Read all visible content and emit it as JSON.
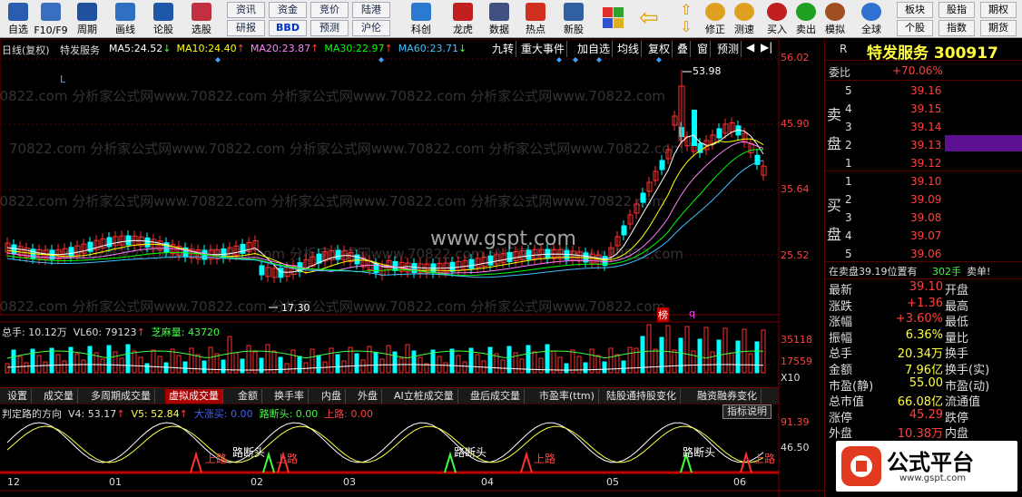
{
  "toolbar": {
    "buttons": [
      {
        "label": "自选",
        "icon": "self-select-icon",
        "color": "#2a5db0"
      },
      {
        "label": "F10/F9",
        "icon": "f10-icon",
        "color": "#3a6fc0"
      },
      {
        "label": "周期",
        "icon": "period-icon",
        "color": "#2050a0"
      },
      {
        "label": "画线",
        "icon": "draw-line-icon",
        "color": "#3070c0"
      },
      {
        "label": "论股",
        "icon": "discuss-icon",
        "color": "#1e56a8"
      },
      {
        "label": "选股",
        "icon": "stock-pick-icon",
        "color": "#c03040"
      }
    ],
    "grid_buttons": [
      {
        "label": "资讯"
      },
      {
        "label": "资金"
      },
      {
        "label": "竞价"
      },
      {
        "label": "陆港"
      },
      {
        "label": "研报"
      },
      {
        "label": "BBD"
      },
      {
        "label": "预测"
      },
      {
        "label": "沪伦"
      }
    ],
    "buttons2": [
      {
        "label": "科创",
        "icon": "kechuang-icon",
        "color": "#2a7ad0"
      },
      {
        "label": "龙虎",
        "icon": "longhu-icon",
        "color": "#c02020"
      },
      {
        "label": "数据",
        "icon": "data-icon",
        "color": "#405080"
      },
      {
        "label": "热点",
        "icon": "hot-icon",
        "color": "#d03020"
      },
      {
        "label": "新股",
        "icon": "newstock-icon",
        "color": "#3060a0"
      }
    ],
    "nav_buttons": [
      {
        "label": "修正",
        "icon": "fix-icon"
      },
      {
        "label": "测速",
        "icon": "speed-icon"
      },
      {
        "label": "买入",
        "icon": "buy-icon"
      },
      {
        "label": "卖出",
        "icon": "sell-icon"
      },
      {
        "label": "模拟",
        "icon": "simulate-icon"
      },
      {
        "label": "全球",
        "icon": "globe-icon"
      }
    ],
    "right_buttons": [
      "板块",
      "股指",
      "期权",
      "个股",
      "指数",
      "期货"
    ]
  },
  "chart": {
    "title": "日线(复权)",
    "stock_name": "特发服务",
    "ma": [
      {
        "label": "MA5:",
        "value": "24.52",
        "arrow": "↓",
        "color": "#ffffff"
      },
      {
        "label": "MA10:",
        "value": "24.40",
        "arrow": "↑",
        "color": "#ffff00"
      },
      {
        "label": "MA20:",
        "value": "23.87",
        "arrow": "↑",
        "color": "#ff80ff"
      },
      {
        "label": "MA30:",
        "value": "22.97",
        "arrow": "↑",
        "color": "#00ff00"
      },
      {
        "label": "MA60:",
        "value": "23.71",
        "arrow": "↓",
        "color": "#40c0ff"
      }
    ],
    "toolbar_right": [
      "九转",
      "重大事件",
      "加自选",
      "均线",
      "复权",
      "叠",
      "窗",
      "预测"
    ],
    "price_axis": [
      "56.02",
      "45.90",
      "35.64",
      "25.52"
    ],
    "high_label": "53.98",
    "low_label": "17.30",
    "watermark_text": "70822.com 分析家公式网www.70822.com 分析家公式网www.70822.com 分析家公式网www.70822.com",
    "watermark_site": "www.gspt.com",
    "marker_bang": "榜",
    "marker_q": "q",
    "marker_L": "L",
    "volume": {
      "label": "总手: 10.12万",
      "vl60": "VL60: 79123",
      "vl60_arrow": "↑",
      "zhima": "芝麻量: 43720",
      "axis_top": "35118",
      "axis_mid": "17559",
      "axis_unit": "X10"
    },
    "tabs": [
      "设置",
      "成交量",
      "多周期成交量",
      "虚拟成交量",
      "金额",
      "换手率",
      "内盘",
      "外盘",
      "AI立桩成交量",
      "盘后成交量",
      "市盈率(ttm)",
      "陆股通持股变化",
      "融资融券变化"
    ],
    "active_tab": "虚拟成交量",
    "indicator": {
      "title": "判定路的方向",
      "v4": "V4: 53.17",
      "v4_arrow": "↑",
      "v5": "V5: 52.84",
      "v5_arrow": "↑",
      "dazhang": "大涨买: 0.00",
      "luduan": "路断头: 0.00",
      "shanglu": "上路: 0.00",
      "help_button": "指标说明",
      "axis_top": "91.39",
      "axis_mid": "46.50",
      "labels": [
        "上路",
        "路断头",
        "上路",
        "路断头",
        "上路",
        "路断头",
        "上路"
      ]
    },
    "date_axis": [
      "12",
      "01",
      "02",
      "03",
      "04",
      "05",
      "06"
    ]
  },
  "quote": {
    "code_label": "R",
    "title": "特发服务 300917",
    "weibi_label": "委比",
    "weibi_value": "+70.06%",
    "sell_label": [
      "卖",
      "盘"
    ],
    "buy_label": [
      "买",
      "盘"
    ],
    "sells": [
      {
        "level": "5",
        "price": "39.16"
      },
      {
        "level": "4",
        "price": "39.15"
      },
      {
        "level": "3",
        "price": "39.14"
      },
      {
        "level": "2",
        "price": "39.13"
      },
      {
        "level": "1",
        "price": "39.12"
      }
    ],
    "buys": [
      {
        "level": "1",
        "price": "39.10"
      },
      {
        "level": "2",
        "price": "39.09"
      },
      {
        "level": "3",
        "price": "39.08"
      },
      {
        "level": "4",
        "price": "39.07"
      },
      {
        "level": "5",
        "price": "39.06"
      }
    ],
    "sell_info": "在卖盘39.19位置有",
    "sell_info_qty": "302手",
    "sell_info_tag": "卖单!",
    "stats": [
      {
        "k1": "最新",
        "v1": "39.10",
        "k2": "开盘",
        "c": "#ff4040"
      },
      {
        "k1": "涨跌",
        "v1": "+1.36",
        "k2": "最高",
        "c": "#ff4040"
      },
      {
        "k1": "涨幅",
        "v1": "+3.60%",
        "k2": "最低",
        "c": "#ff4040"
      },
      {
        "k1": "振幅",
        "v1": "6.36%",
        "k2": "量比",
        "c": "#ffff40"
      },
      {
        "k1": "总手",
        "v1": "20.34万",
        "k2": "换手",
        "c": "#ffff40"
      },
      {
        "k1": "金额",
        "v1": "7.96亿",
        "k2": "换手(实)",
        "c": "#ffff40"
      },
      {
        "k1": "市盈(静)",
        "v1": "55.00",
        "k2": "市盈(动)",
        "c": "#ffff40"
      },
      {
        "k1": "总市值",
        "v1": "66.08亿",
        "k2": "流通值",
        "c": "#ffff40"
      },
      {
        "k1": "涨停",
        "v1": "45.29",
        "k2": "跌停",
        "c": "#ff4040"
      },
      {
        "k1": "外盘",
        "v1": "10.38万",
        "k2": "内盘",
        "c": "#ff4040"
      }
    ],
    "logo_text": "公式平台",
    "logo_url": "www.gspt.com"
  }
}
